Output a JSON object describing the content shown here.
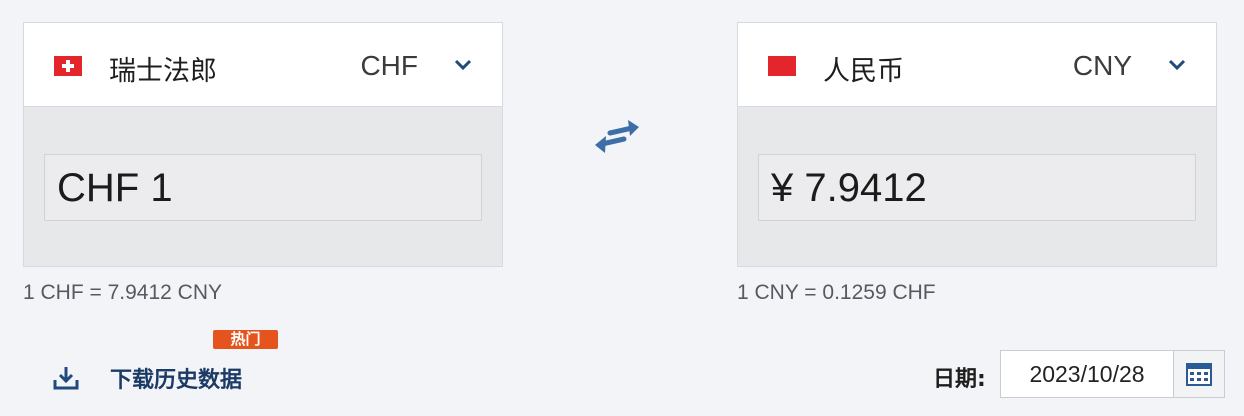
{
  "from": {
    "name": "瑞士法郎",
    "code": "CHF",
    "flag_icon": "switzerland-flag-icon",
    "amount": "CHF 1",
    "rate_note": "1 CHF = 7.9412 CNY"
  },
  "to": {
    "name": "人民币",
    "code": "CNY",
    "flag_icon": "china-flag-icon",
    "amount": "¥ 7.9412",
    "rate_note": "1 CNY = 0.1259 CHF"
  },
  "swap_icon": "swap-arrows-icon",
  "footer": {
    "hot_badge": "热门",
    "download_label": "下载历史数据",
    "download_icon": "download-icon",
    "date_label": "日期:",
    "date_value": "2023/10/28",
    "calendar_icon": "calendar-icon"
  },
  "colors": {
    "accent": "#1f4a7e",
    "badge": "#e5541c",
    "panel_bg": "#e7e8ea"
  }
}
